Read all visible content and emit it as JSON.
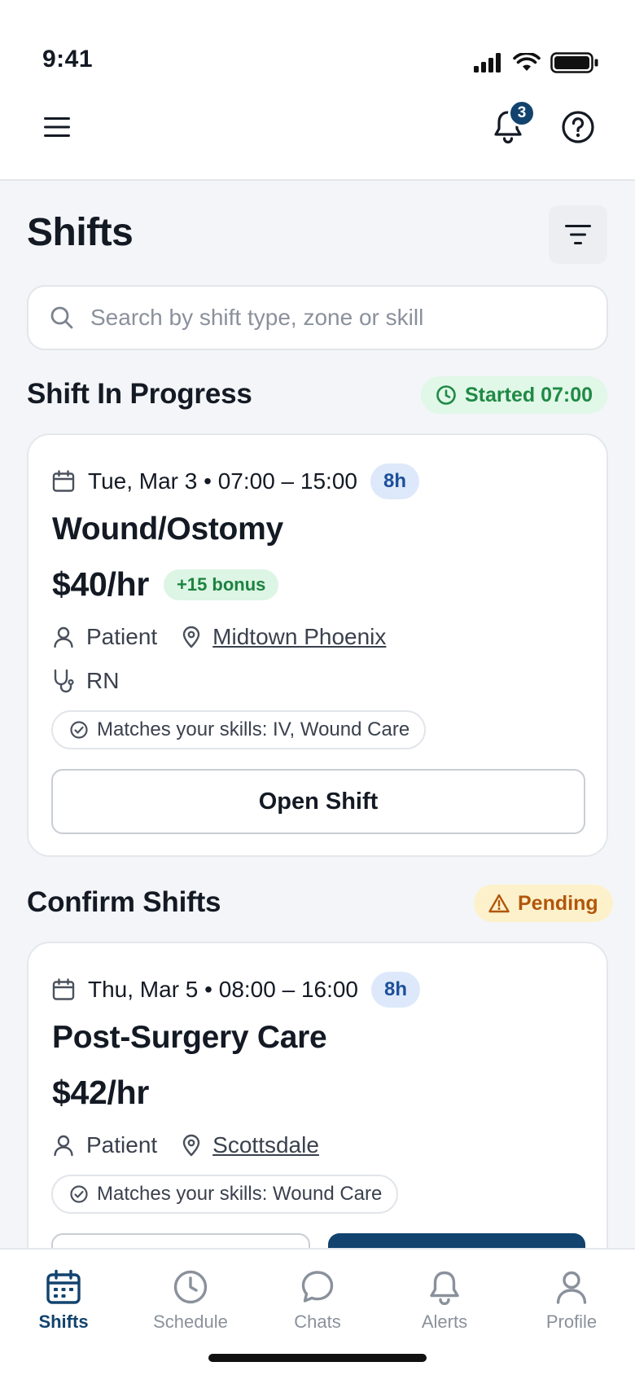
{
  "status_bar": {
    "time": "9:41"
  },
  "header": {
    "notification_count": "3"
  },
  "page": {
    "title": "Shifts",
    "search_placeholder": "Search by shift type, zone or skill"
  },
  "sections": {
    "in_progress": {
      "title": "Shift In Progress",
      "status": "Started 07:00",
      "card": {
        "date": "Tue, Mar 3 • 07:00 – 15:00",
        "hours": "8h",
        "title": "Wound/Ostomy",
        "rate": "$40/hr",
        "bonus": "+15 bonus",
        "patient_label": "Patient",
        "location": "Midtown Phoenix",
        "role": "RN",
        "skills": "Matches your skills: IV, Wound Care",
        "button": "Open Shift"
      }
    },
    "confirm": {
      "title": "Confirm Shifts",
      "status": "Pending",
      "card": {
        "date": "Thu, Mar 5 • 08:00 – 16:00",
        "hours": "8h",
        "title": "Post-Surgery Care",
        "rate": "$42/hr",
        "patient_label": "Patient",
        "location": "Scottsdale",
        "skills": "Matches your skills: Wound Care"
      }
    }
  },
  "bottom_nav": {
    "items": [
      {
        "label": "Shifts",
        "icon": "calendar-icon",
        "active": true
      },
      {
        "label": "Schedule",
        "icon": "clock-icon"
      },
      {
        "label": "Chats",
        "icon": "chat-bubble-icon"
      },
      {
        "label": "Alerts",
        "icon": "bell-icon"
      },
      {
        "label": "Profile",
        "icon": "user-icon"
      }
    ]
  },
  "colors": {
    "primary": "#12436e",
    "success": "#1f8a45",
    "warning": "#b2560b",
    "background": "#f3f5f8"
  }
}
